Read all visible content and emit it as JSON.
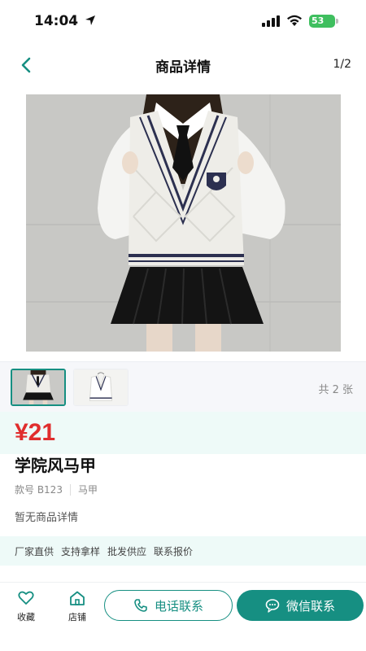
{
  "status_bar": {
    "time": "14:04",
    "battery": "53"
  },
  "nav": {
    "title": "商品详情",
    "page_indicator": "1/2"
  },
  "gallery": {
    "count_label": "共 2 张",
    "selected_index": 0
  },
  "product": {
    "price": "¥21",
    "title": "学院风马甲",
    "sku": "款号 B123",
    "category": "马甲",
    "detail": "暂无商品详情"
  },
  "tags": [
    "厂家直供",
    "支持拿样",
    "批发供应",
    "联系报价"
  ],
  "bottom_bar": {
    "favorite_label": "收藏",
    "shop_label": "店铺",
    "call_label": "电话联系",
    "wechat_label": "微信联系"
  },
  "colors": {
    "accent": "#168f82",
    "price": "#e02d2d",
    "section_bg": "#eefaf8"
  },
  "icons": {
    "back": "chevron-left-icon",
    "favorite": "heart-icon",
    "shop": "home-icon",
    "call": "phone-icon",
    "wechat": "chat-bubble-icon"
  }
}
